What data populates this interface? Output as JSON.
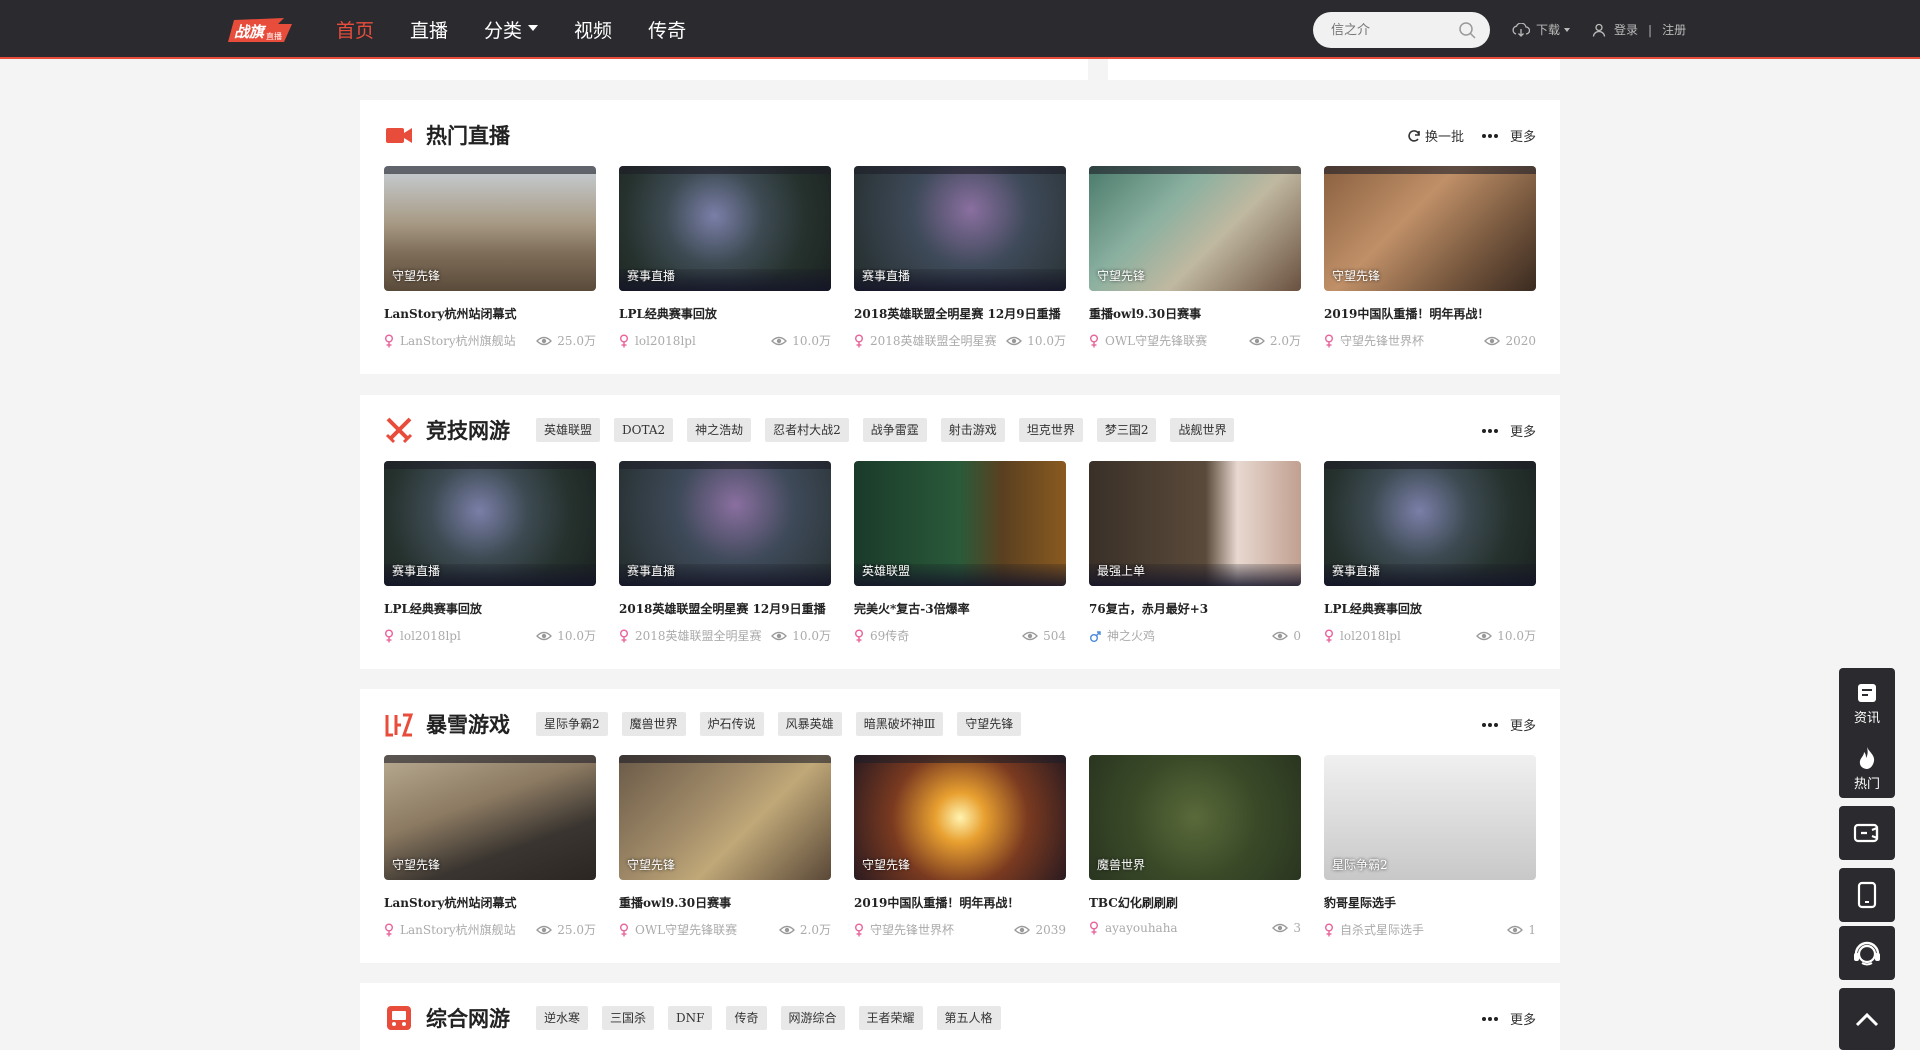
{
  "nav": {
    "logo_text": "战旗直播",
    "items": [
      {
        "label": "首页",
        "active": true
      },
      {
        "label": "直播"
      },
      {
        "label": "分类",
        "dropdown": true
      },
      {
        "label": "视频"
      },
      {
        "label": "传奇"
      }
    ],
    "search_placeholder": "信之介",
    "download_label": "下载",
    "login_label": "登录",
    "separator": "|",
    "register_label": "注册"
  },
  "colors": {
    "accent": "#e84d3c",
    "nav_bg": "#2b2b2f",
    "female_icon": "#e8649a",
    "male_icon": "#4a8ad8"
  },
  "hot_live": {
    "title": "热门直播",
    "refresh_label": "换一批",
    "more_label": "更多",
    "cards": [
      {
        "label": "守望先锋",
        "title": "LanStory杭州站闭幕式",
        "anchor": "LanStory杭州旗舰站",
        "views": "25.0万",
        "gender": "female"
      },
      {
        "label": "赛事直播",
        "title": "LPL经典赛事回放",
        "anchor": "lol2018lpl",
        "views": "10.0万",
        "gender": "female"
      },
      {
        "label": "赛事直播",
        "title": "2018英雄联盟全明星赛 12月9日重播",
        "anchor": "2018英雄联盟全明星赛",
        "views": "10.0万",
        "gender": "female"
      },
      {
        "label": "守望先锋",
        "title": "重播owl9.30日赛事",
        "anchor": "OWL守望先锋联赛",
        "views": "2.0万",
        "gender": "female"
      },
      {
        "label": "守望先锋",
        "title": "2019中国队重播！明年再战！",
        "anchor": "守望先锋世界杯",
        "views": "2020",
        "gender": "female"
      }
    ]
  },
  "esports": {
    "title": "竞技网游",
    "tags": [
      "英雄联盟",
      "DOTA2",
      "神之浩劫",
      "忍者村大战2",
      "战争雷霆",
      "射击游戏",
      "坦克世界",
      "梦三国2",
      "战舰世界"
    ],
    "more_label": "更多",
    "cards": [
      {
        "label": "赛事直播",
        "title": "LPL经典赛事回放",
        "anchor": "lol2018lpl",
        "views": "10.0万",
        "gender": "female"
      },
      {
        "label": "赛事直播",
        "title": "2018英雄联盟全明星赛 12月9日重播",
        "anchor": "2018英雄联盟全明星赛",
        "views": "10.0万",
        "gender": "female"
      },
      {
        "label": "英雄联盟",
        "title": "完美火*复古-3倍爆率",
        "anchor": "69传奇",
        "views": "504",
        "gender": "female"
      },
      {
        "label": "最强上单",
        "title": "76复古，赤月最好+3",
        "anchor": "神之火鸡",
        "views": "0",
        "gender": "male"
      },
      {
        "label": "赛事直播",
        "title": "LPL经典赛事回放",
        "anchor": "lol2018lpl",
        "views": "10.0万",
        "gender": "female"
      }
    ]
  },
  "blizzard": {
    "title": "暴雪游戏",
    "tags": [
      "星际争霸2",
      "魔兽世界",
      "炉石传说",
      "风暴英雄",
      "暗黑破坏神Ⅲ",
      "守望先锋"
    ],
    "more_label": "更多",
    "cards": [
      {
        "label": "守望先锋",
        "title": "LanStory杭州站闭幕式",
        "anchor": "LanStory杭州旗舰站",
        "views": "25.0万",
        "gender": "female"
      },
      {
        "label": "守望先锋",
        "title": "重播owl9.30日赛事",
        "anchor": "OWL守望先锋联赛",
        "views": "2.0万",
        "gender": "female"
      },
      {
        "label": "守望先锋",
        "title": "2019中国队重播！明年再战！",
        "anchor": "守望先锋世界杯",
        "views": "2039",
        "gender": "female"
      },
      {
        "label": "魔兽世界",
        "title": "TBC幻化刷刷刷",
        "anchor": "ayayouhaha",
        "views": "3",
        "gender": "female"
      },
      {
        "label": "星际争霸2",
        "title": "豹哥星际选手",
        "anchor": "自杀式星际选手",
        "views": "1",
        "gender": "female"
      }
    ]
  },
  "online": {
    "title": "综合网游",
    "tags": [
      "逆水寒",
      "三国杀",
      "DNF",
      "传奇",
      "网游综合",
      "王者荣耀",
      "第五人格"
    ],
    "more_label": "更多"
  },
  "sidebar": {
    "news_label": "资讯",
    "hot_label": "热门"
  }
}
